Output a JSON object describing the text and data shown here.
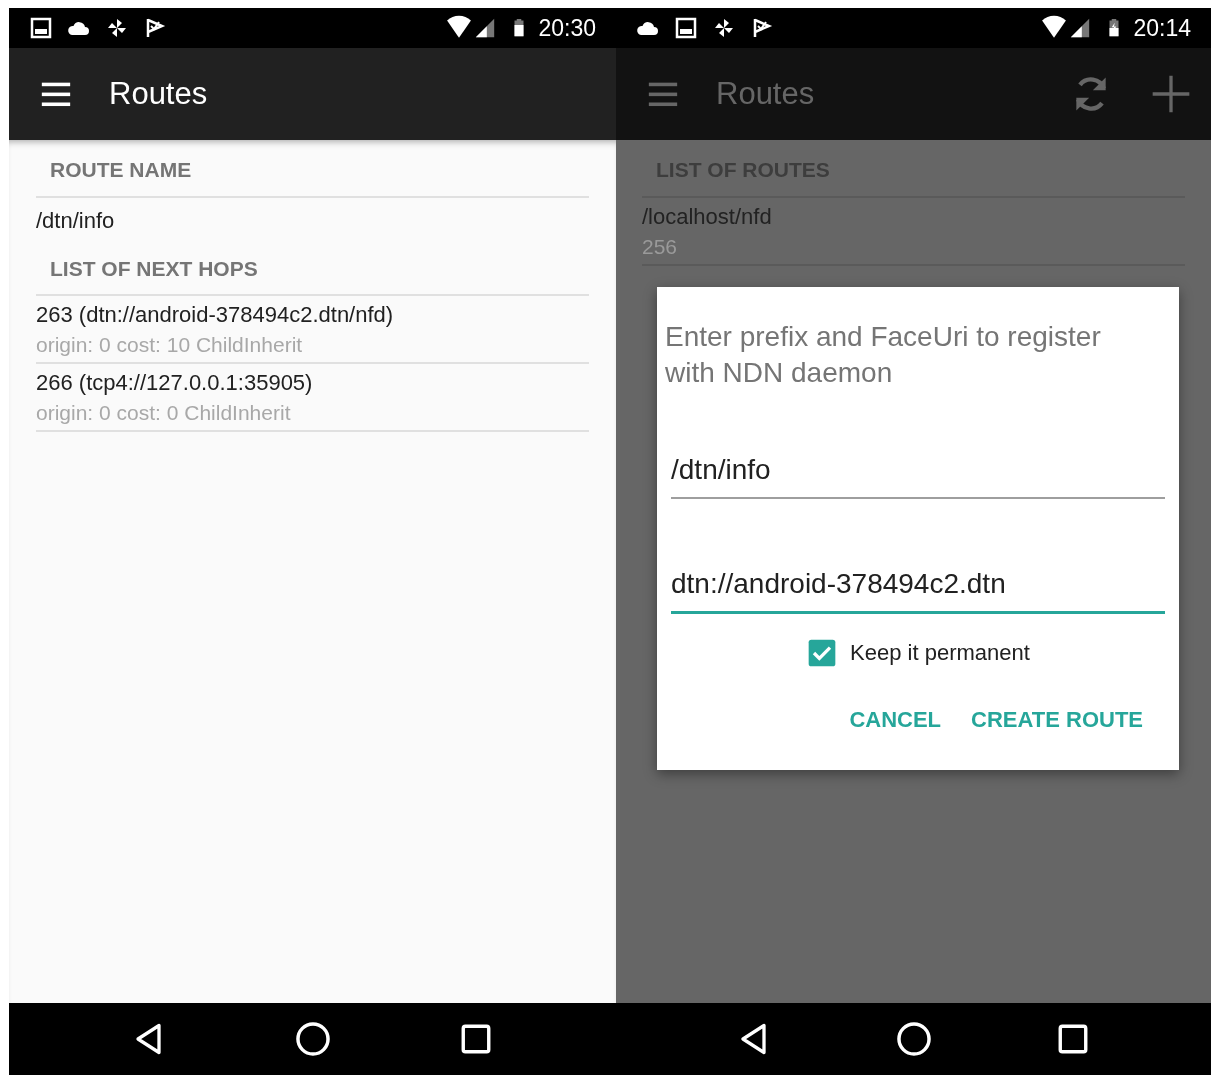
{
  "detail_screen": {
    "status_bar": {
      "time": "20:30"
    },
    "toolbar": {
      "title": "Routes"
    },
    "route_name": {
      "header": "ROUTE NAME",
      "value": "/dtn/info"
    },
    "next_hops": {
      "header": "LIST OF NEXT HOPS",
      "items": [
        {
          "title": "263 (dtn://android-378494c2.dtn/nfd)",
          "subtitle": "origin: 0 cost: 10 ChildInherit"
        },
        {
          "title": "266 (tcp4://127.0.0.1:35905)",
          "subtitle": "origin: 0 cost: 0 ChildInherit"
        }
      ]
    }
  },
  "list_screen": {
    "status_bar": {
      "time": "20:14"
    },
    "toolbar": {
      "title": "Routes"
    },
    "routes": {
      "header": "LIST OF ROUTES",
      "items": [
        {
          "title": "/localhost/nfd",
          "subtitle": "256"
        }
      ]
    },
    "dialog": {
      "message": "Enter prefix and FaceUri to register with NDN daemon",
      "fields": [
        {
          "value": "/dtn/info",
          "focused": false
        },
        {
          "value": "dtn://android-378494c2.dtn",
          "focused": true
        }
      ],
      "checkbox": {
        "label": "Keep it permanent",
        "checked": true
      },
      "buttons": [
        "CANCEL",
        "CREATE ROUTE"
      ]
    }
  }
}
